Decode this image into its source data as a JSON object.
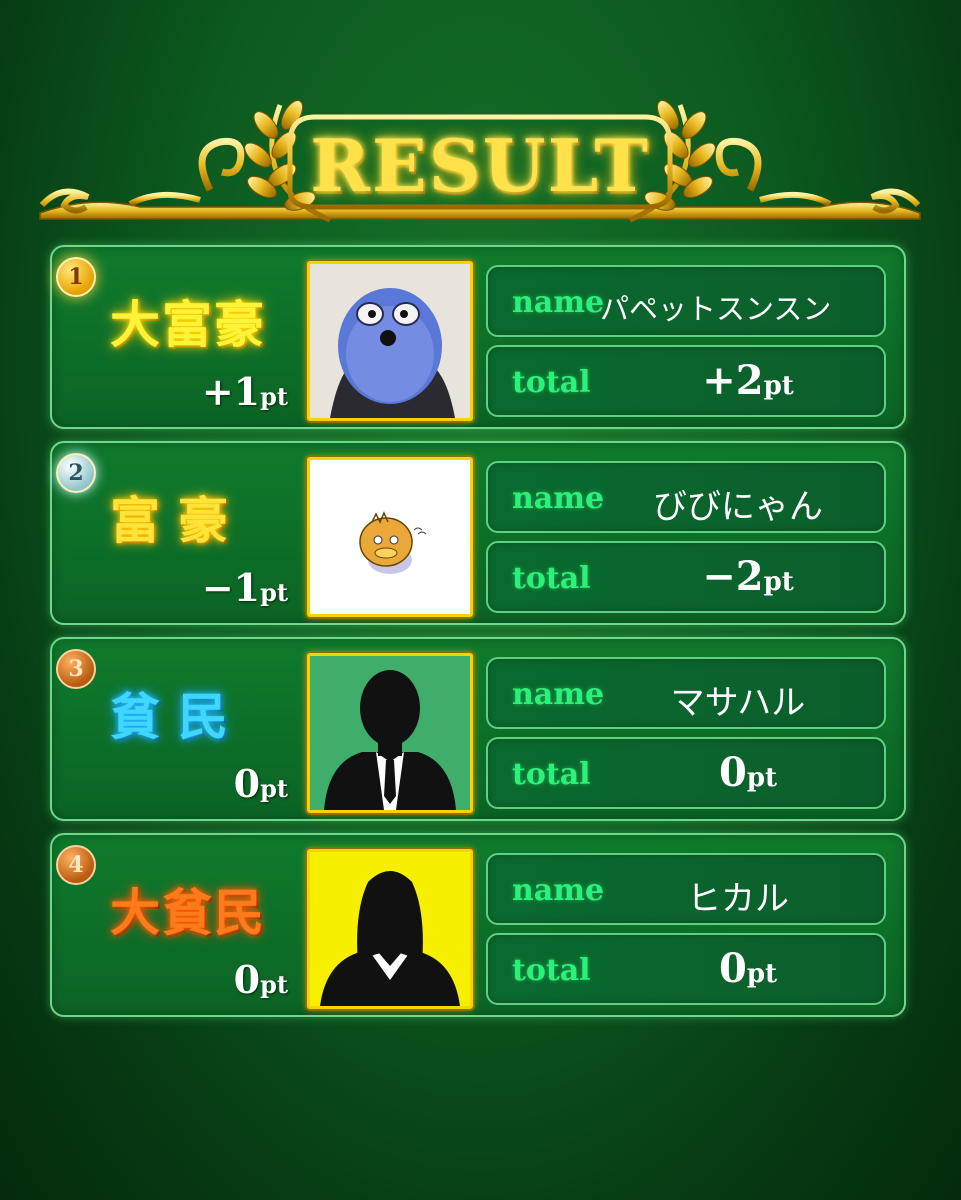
{
  "header": {
    "title": "RESULT"
  },
  "labels": {
    "name": "name",
    "total": "total"
  },
  "players": [
    {
      "medal": "1",
      "rank_title": "大富豪",
      "round_points": "+1",
      "round_unit": "pt",
      "name": "パペットスンスン",
      "total_points": "+2",
      "total_unit": "pt",
      "avatar": "blue-puppet-photo"
    },
    {
      "medal": "2",
      "rank_title": "富豪",
      "round_points": "−1",
      "round_unit": "pt",
      "name": "びびにゃん",
      "total_points": "−2",
      "total_unit": "pt",
      "avatar": "duck-character-illustration"
    },
    {
      "medal": "3",
      "rank_title": "貧民",
      "round_points": "0",
      "round_unit": "pt",
      "name": "マサハル",
      "total_points": "0",
      "total_unit": "pt",
      "avatar": "male-silhouette-green"
    },
    {
      "medal": "4",
      "rank_title": "大貧民",
      "round_points": "0",
      "round_unit": "pt",
      "name": "ヒカル",
      "total_points": "0",
      "total_unit": "pt",
      "avatar": "female-silhouette-yellow"
    }
  ],
  "colors": {
    "gold": "#ffe14a",
    "rank1": "#fff33a",
    "rank2": "#ffe23a",
    "rank3": "#3fd6ff",
    "rank4": "#ff7a1a",
    "label_green": "#2bf07a"
  }
}
